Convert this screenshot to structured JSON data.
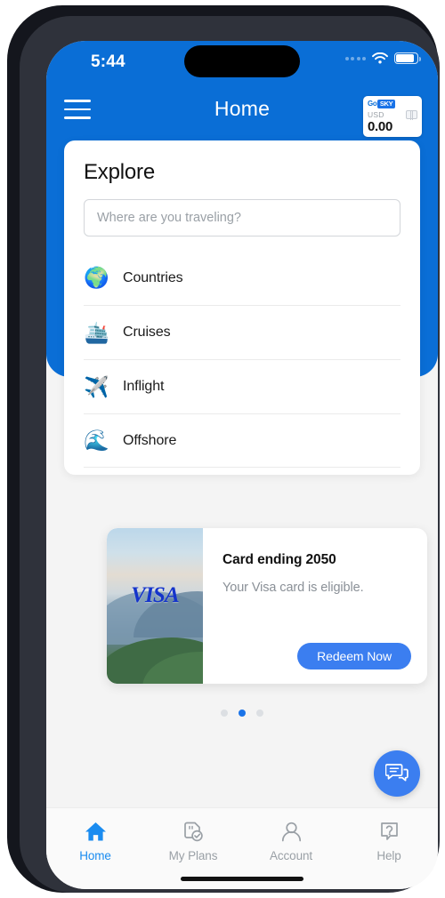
{
  "status_bar": {
    "time": "5:44",
    "signal_icon": "signal-dots-icon",
    "wifi_icon": "wifi-icon",
    "battery_icon": "battery-icon"
  },
  "app_bar": {
    "menu_icon": "hamburger-menu-icon",
    "title": "Home",
    "balance_card": {
      "brand_go": "Go",
      "brand_sky": "SKY",
      "currency": "USD",
      "amount": "0.00",
      "chip_icon": "card-chip-icon"
    }
  },
  "explore": {
    "title": "Explore",
    "search_placeholder": "Where are you traveling?",
    "search_value": "",
    "items": [
      {
        "icon": "globe-icon",
        "glyph": "🌍",
        "label": "Countries"
      },
      {
        "icon": "cruise-ship-icon",
        "glyph": "🛳️",
        "label": "Cruises"
      },
      {
        "icon": "airplane-icon",
        "glyph": "✈️",
        "label": "Inflight"
      },
      {
        "icon": "wave-icon",
        "glyph": "🌊",
        "label": "Offshore"
      }
    ]
  },
  "offer_card": {
    "brand_mark": "VISA",
    "title": "Card ending 2050",
    "subtitle": "Your Visa card is eligible.",
    "button_label": "Redeem Now",
    "thumbnail_alt": "mountain-landscape-image"
  },
  "pager": {
    "total": 3,
    "active_index": 1
  },
  "chat_fab": {
    "icon": "chat-bubbles-icon"
  },
  "bottom_nav": {
    "items": [
      {
        "icon": "home-icon",
        "label": "Home",
        "active": true
      },
      {
        "icon": "my-plans-icon",
        "label": "My Plans",
        "active": false
      },
      {
        "icon": "account-person-icon",
        "label": "Account",
        "active": false
      },
      {
        "icon": "help-question-icon",
        "label": "Help",
        "active": false
      }
    ]
  },
  "colors": {
    "header_blue": "#0a6ed6",
    "accent_blue": "#3b7ef0",
    "active_nav": "#1a8cf0",
    "visa_blue": "#1434cb",
    "muted_text": "#9aa0a6"
  }
}
